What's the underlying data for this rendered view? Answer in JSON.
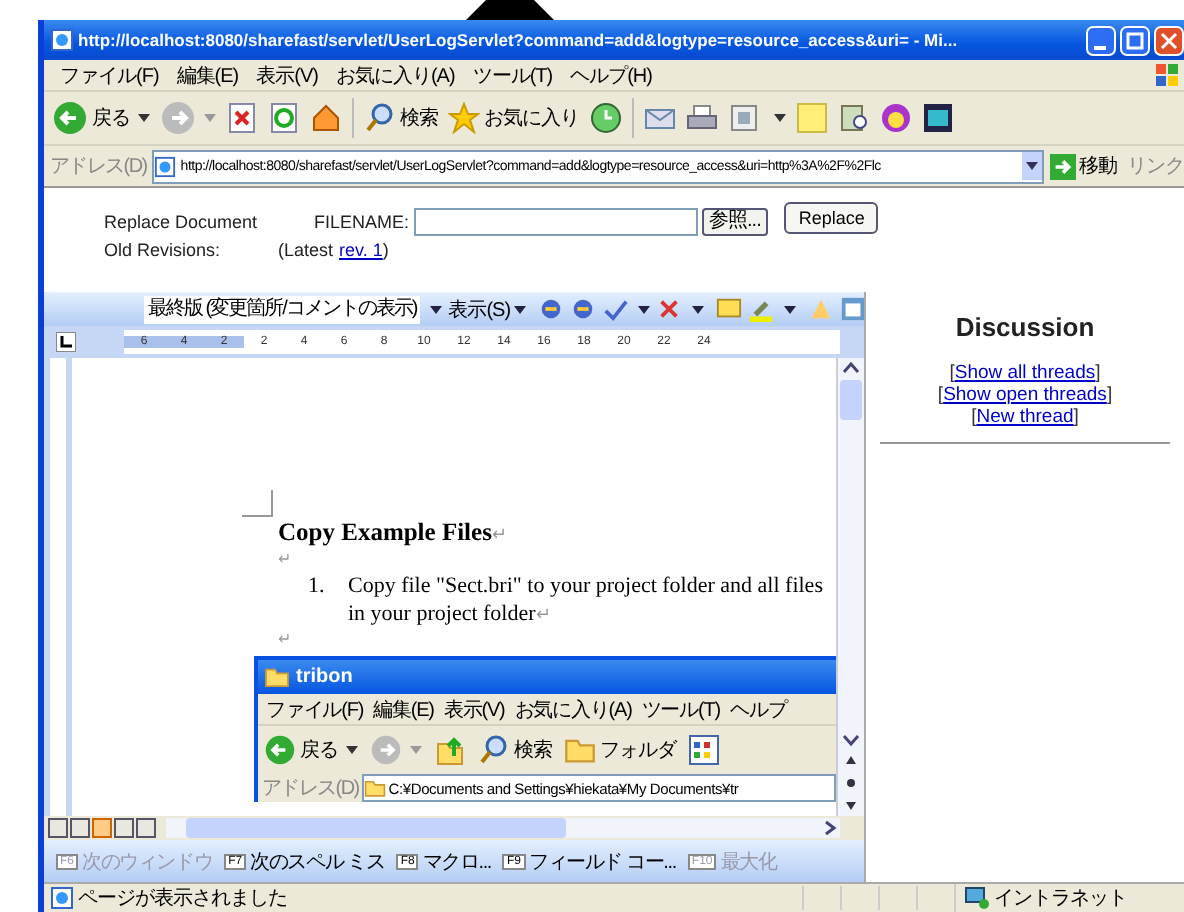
{
  "window": {
    "title": "http://localhost:8080/sharefast/servlet/UserLogServlet?command=add&logtype=resource_access&uri= - Mi..."
  },
  "menu": [
    "ファイル(F)",
    "編集(E)",
    "表示(V)",
    "お気に入り(A)",
    "ツール(T)",
    "ヘルプ(H)"
  ],
  "toolbar": {
    "back": "戻る",
    "search": "検索",
    "favorites": "お気に入り"
  },
  "address": {
    "label": "アドレス(D)",
    "value": "http://localhost:8080/sharefast/servlet/UserLogServlet?command=add&logtype=resource_access&uri=http%3A%2F%2Flc",
    "go": "移動",
    "links": "リンク"
  },
  "replace": {
    "label": "Replace Document",
    "filename_label": "FILENAME:",
    "browse": "参照...",
    "button": "Replace",
    "revisions_label": "Old Revisions:",
    "latest_prefix": "(Latest",
    "latest_link": "rev. 1",
    "latest_suffix": ")"
  },
  "word": {
    "review_mode": "最終版 (変更箇所/コメントの表示)",
    "show": "表示(S)",
    "ruler": [
      "6",
      "4",
      "2",
      "2",
      "4",
      "6",
      "8",
      "10",
      "12",
      "14",
      "16",
      "18",
      "20",
      "22",
      "24"
    ],
    "heading": "Copy Example Files",
    "mark": "↵",
    "list_number": "1.",
    "list_lines": [
      "Copy file \"Sect.bri\" to your project folder and all files",
      "in your project folder"
    ],
    "views": [
      {
        "selected": false
      },
      {
        "selected": false
      },
      {
        "selected": true
      },
      {
        "selected": false
      },
      {
        "selected": false
      }
    ],
    "fkeys": [
      {
        "key": "F6",
        "label": "次のウィンドウ",
        "disabled": true
      },
      {
        "key": "F7",
        "label": "次のスペル ミス",
        "disabled": false
      },
      {
        "key": "F8",
        "label": "マクロ...",
        "disabled": false
      },
      {
        "key": "F9",
        "label": "フィールド コー...",
        "disabled": false
      },
      {
        "key": "F10",
        "label": "最大化",
        "disabled": true
      }
    ]
  },
  "explorer": {
    "title": "tribon",
    "menu": [
      "ファイル(F)",
      "編集(E)",
      "表示(V)",
      "お気に入り(A)",
      "ツール(T)",
      "ヘルプ"
    ],
    "back": "戻る",
    "search": "検索",
    "folders": "フォルダ",
    "address_label": "アドレス(D)",
    "address": "C:¥Documents and Settings¥hiekata¥My Documents¥tr"
  },
  "discussion": {
    "title": "Discussion",
    "parts": [
      {
        "kind": "text",
        "text": "["
      },
      {
        "kind": "link",
        "text": "Show all threads"
      },
      {
        "kind": "text",
        "text": "] ["
      },
      {
        "kind": "link",
        "text": "Show open threads"
      },
      {
        "kind": "text",
        "text": "] ["
      },
      {
        "kind": "link",
        "text": "New thread"
      },
      {
        "kind": "text",
        "text": "]"
      }
    ]
  },
  "status_bar": {
    "text": "ページが表示されました",
    "zone": "イントラネット"
  }
}
